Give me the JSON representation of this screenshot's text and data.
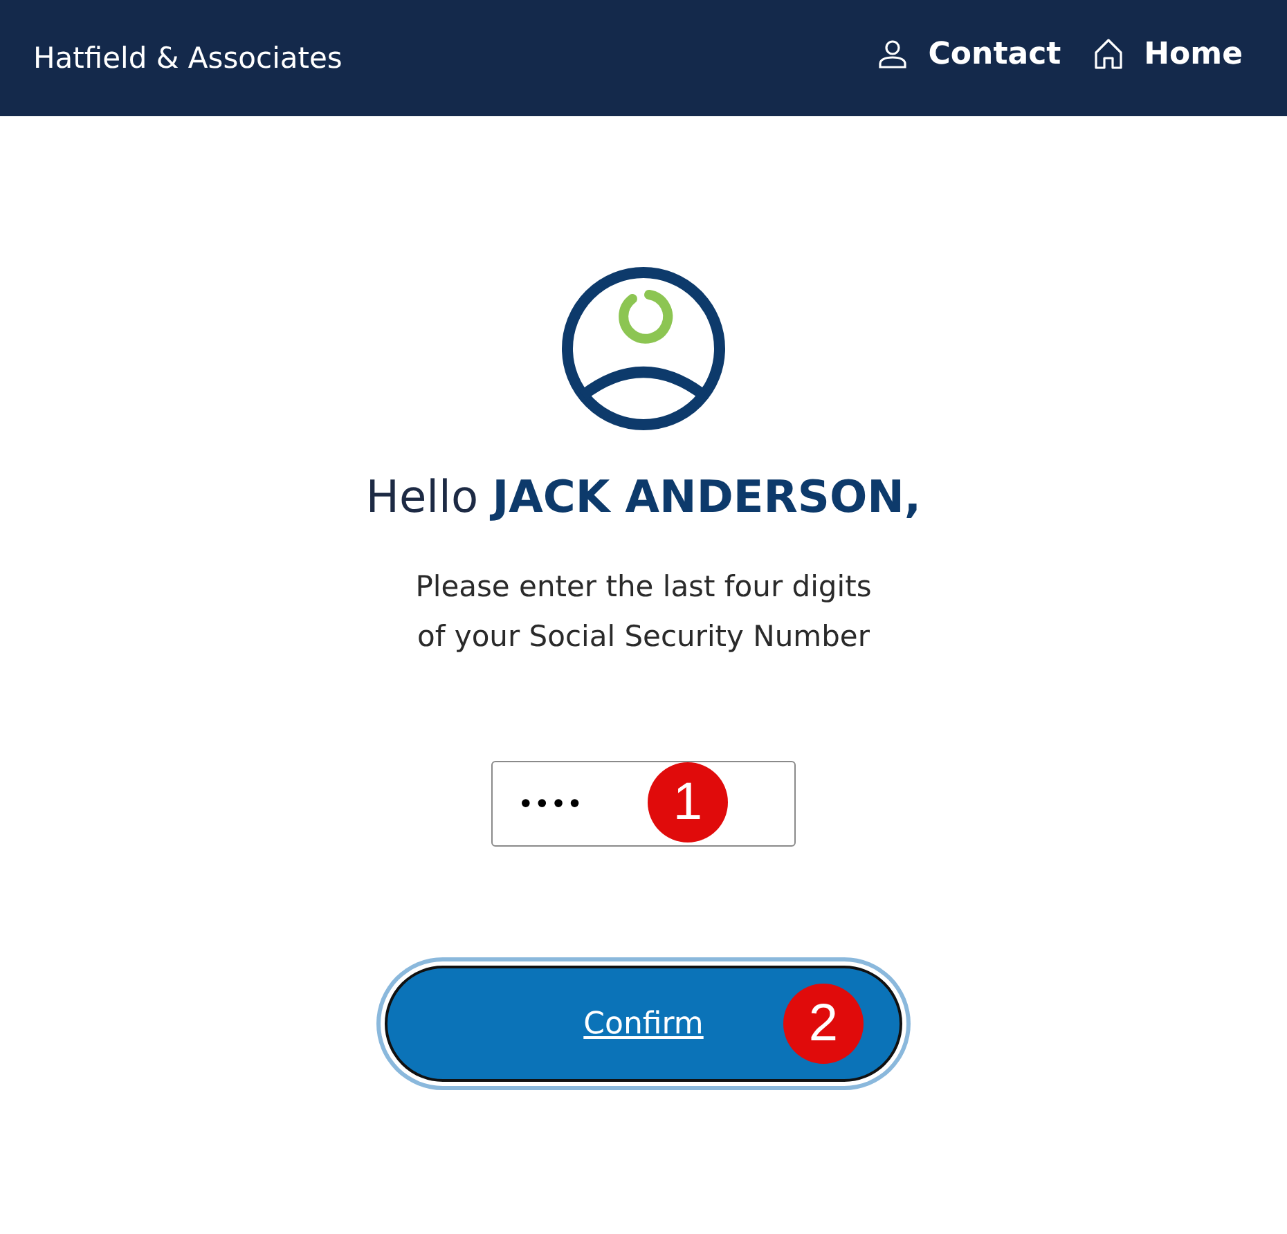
{
  "header": {
    "brand": "Hatfield & Associates",
    "nav": [
      {
        "label": "Contact",
        "kind": "person"
      },
      {
        "label": "Home",
        "kind": "home"
      }
    ]
  },
  "greeting": "Hello **JACK ANDERSON,**",
  "prompt": "Please enter the last four digits\nof your Social Security Number",
  "ssn_field": {
    "value": "••••",
    "step": "1"
  },
  "confirm_button": {
    "label": "Confirm",
    "step": "2"
  }
}
